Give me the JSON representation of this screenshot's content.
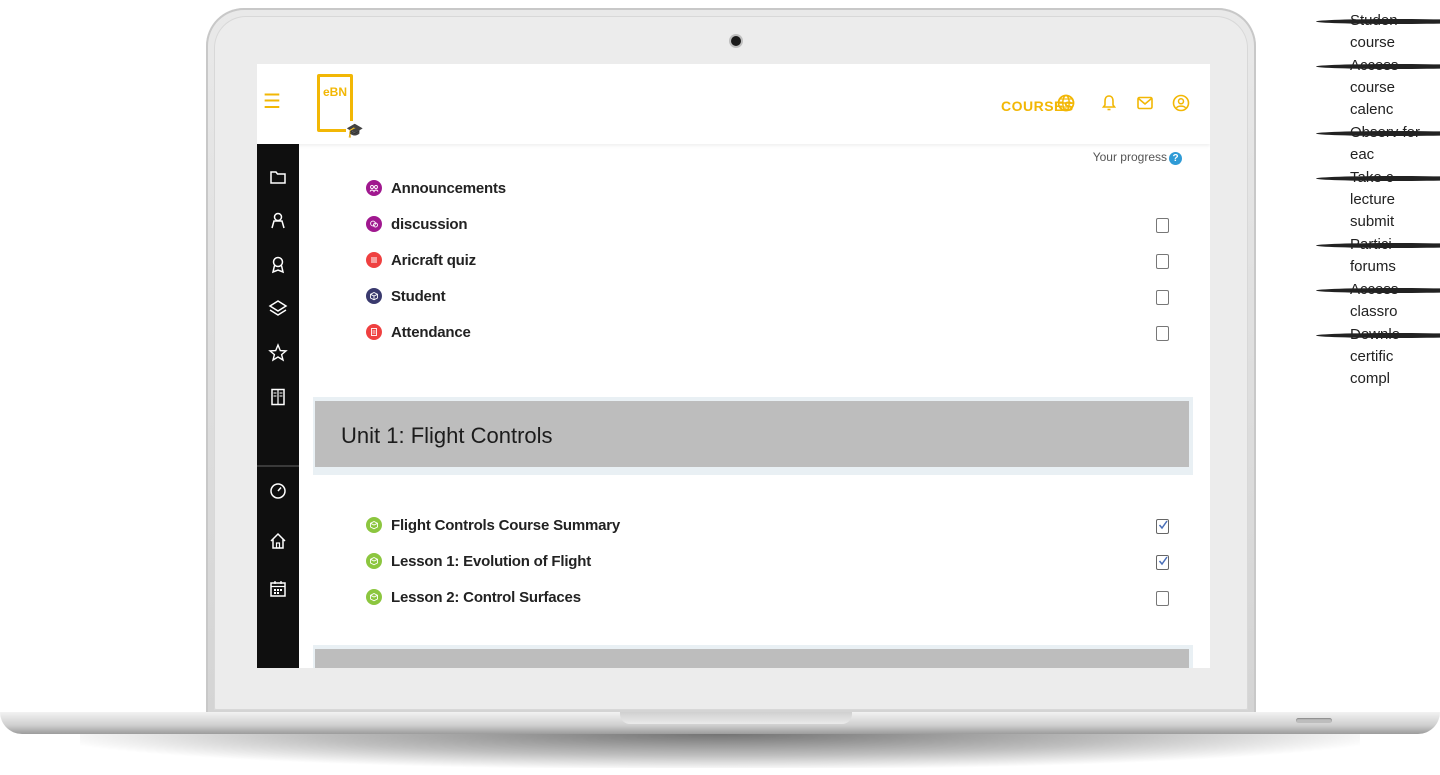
{
  "header": {
    "menu_icon": "hamburger-icon",
    "logo_text": "eBN",
    "courses_label": "COURSES",
    "icons": [
      "globe-icon",
      "bell-icon",
      "mail-icon",
      "user-icon"
    ],
    "accent_color": "#f2b705"
  },
  "sidebar": {
    "items": [
      {
        "icon": "folder-icon"
      },
      {
        "icon": "user-badge-icon"
      },
      {
        "icon": "award-icon"
      },
      {
        "icon": "layers-icon"
      },
      {
        "icon": "star-icon"
      },
      {
        "icon": "book-icon"
      },
      {
        "icon": "dashboard-icon"
      },
      {
        "icon": "home-icon"
      },
      {
        "icon": "calendar-icon"
      }
    ]
  },
  "progress": {
    "label": "Your progress",
    "help": "?"
  },
  "general_activities": [
    {
      "label": "Announcements",
      "icon_color": "#a0188f",
      "has_checkbox": false,
      "checked": false
    },
    {
      "label": "discussion",
      "icon_color": "#a0188f",
      "has_checkbox": true,
      "checked": false
    },
    {
      "label": "Aricraft quiz",
      "icon_color": "#ef4040",
      "has_checkbox": true,
      "checked": false
    },
    {
      "label": "Student",
      "icon_color": "#3a3a6e",
      "has_checkbox": true,
      "checked": false
    },
    {
      "label": "Attendance",
      "icon_color": "#ef4040",
      "has_checkbox": true,
      "checked": false
    }
  ],
  "section": {
    "title": "Unit 1: Flight Controls"
  },
  "unit_activities": [
    {
      "label": "Flight Controls Course Summary",
      "icon_color": "#8cc63f",
      "checked": true
    },
    {
      "label": "Lesson 1: Evolution of Flight",
      "icon_color": "#8cc63f",
      "checked": true
    },
    {
      "label": "Lesson 2: Control Surfaces",
      "icon_color": "#8cc63f",
      "checked": false
    }
  ],
  "side_list": {
    "items": [
      "Studen course",
      "Access course calenc",
      "Observ for eac",
      "Take c lecture submit",
      "Partici forums",
      "Access classro",
      "Downlo certific compl"
    ]
  }
}
